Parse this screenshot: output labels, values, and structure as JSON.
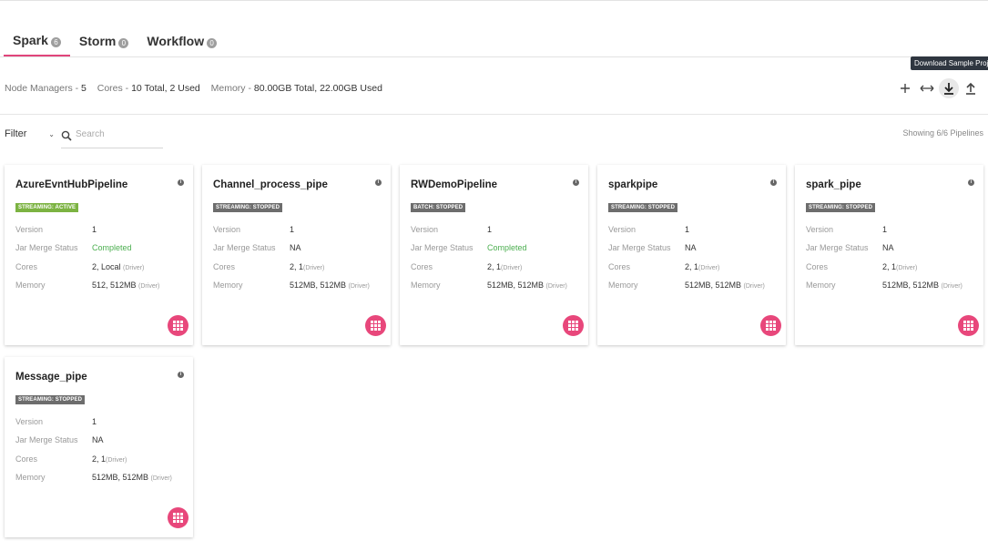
{
  "tabs": [
    {
      "label": "Spark",
      "count": "6",
      "active": true
    },
    {
      "label": "Storm",
      "count": "0",
      "active": false
    },
    {
      "label": "Workflow",
      "count": "0",
      "active": false
    }
  ],
  "stats": {
    "node_managers_label": "Node Managers - ",
    "node_managers_value": "5",
    "cores_label": "Cores - ",
    "cores_value": "10 Total, 2 Used",
    "memory_label": "Memory - ",
    "memory_value": "80.00GB Total, 22.00GB Used"
  },
  "toolbar": {
    "tooltip": "Download Sample Project",
    "icons": [
      "plus-icon",
      "arrows-horizontal-icon",
      "download-icon",
      "upload-icon"
    ]
  },
  "filter": {
    "label": "Filter"
  },
  "search": {
    "placeholder": "Search",
    "value": ""
  },
  "showing": "Showing 6/6 Pipelines",
  "labels": {
    "version": "Version",
    "jar_merge_status": "Jar Merge Status",
    "cores": "Cores",
    "memory": "Memory"
  },
  "colors": {
    "accent": "#e8477b",
    "active_badge": "#7cb342",
    "stopped_badge": "#6d6d6d",
    "completed": "#4caf50"
  },
  "pipelines": [
    {
      "name": "AzureEvntHubPipeline",
      "status": "STREAMING: ACTIVE",
      "version": "1",
      "jar_status": "Completed",
      "cores": "2, Local ",
      "cores_driver": "(Driver)",
      "memory": "512, 512MB ",
      "memory_driver": "(Driver)"
    },
    {
      "name": "Channel_process_pipe",
      "status": "STREAMING: STOPPED",
      "version": "1",
      "jar_status": "NA",
      "cores": "2, 1",
      "cores_driver": "(Driver)",
      "memory": "512MB, 512MB ",
      "memory_driver": "(Driver)"
    },
    {
      "name": "RWDemoPipeline",
      "status": "BATCH: STOPPED",
      "version": "1",
      "jar_status": "Completed",
      "cores": "2, 1",
      "cores_driver": "(Driver)",
      "memory": "512MB, 512MB ",
      "memory_driver": "(Driver)"
    },
    {
      "name": "sparkpipe",
      "status": "STREAMING: STOPPED",
      "version": "1",
      "jar_status": "NA",
      "cores": "2, 1",
      "cores_driver": "(Driver)",
      "memory": "512MB, 512MB ",
      "memory_driver": "(Driver)"
    },
    {
      "name": "spark_pipe",
      "status": "STREAMING: STOPPED",
      "version": "1",
      "jar_status": "NA",
      "cores": "2, 1",
      "cores_driver": "(Driver)",
      "memory": "512MB, 512MB ",
      "memory_driver": "(Driver)"
    },
    {
      "name": "Message_pipe",
      "status": "STREAMING: STOPPED",
      "version": "1",
      "jar_status": "NA",
      "cores": "2, 1",
      "cores_driver": "(Driver)",
      "memory": "512MB, 512MB ",
      "memory_driver": "(Driver)"
    }
  ]
}
